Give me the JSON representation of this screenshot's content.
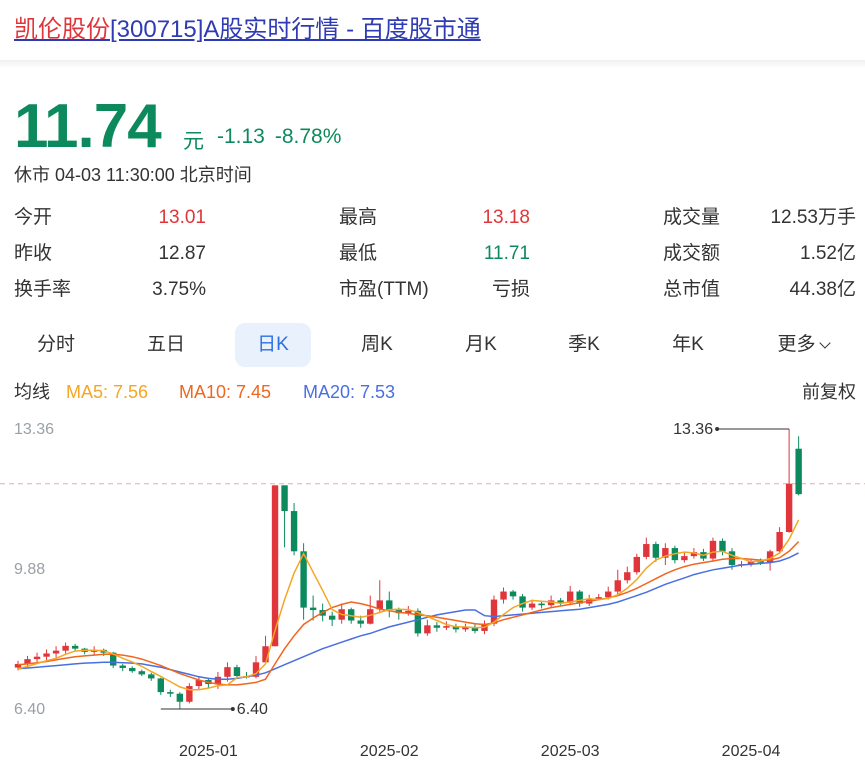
{
  "page_title": {
    "name": "凯伦股份",
    "rest": "[300715]A股实时行情 - 百度股市通"
  },
  "quote": {
    "price": "11.74",
    "unit": "元",
    "change": "-1.13",
    "change_pct": "-8.78%",
    "status": "休市 04-03 11:30:00 北京时间"
  },
  "stats": [
    [
      {
        "label": "今开",
        "value": "13.01",
        "tone": "red"
      },
      {
        "label": "最高",
        "value": "13.18",
        "tone": "red"
      },
      {
        "label": "成交量",
        "value": "12.53万手",
        "tone": "dark"
      }
    ],
    [
      {
        "label": "昨收",
        "value": "12.87",
        "tone": "dark"
      },
      {
        "label": "最低",
        "value": "11.71",
        "tone": "green"
      },
      {
        "label": "成交额",
        "value": "1.52亿",
        "tone": "dark"
      }
    ],
    [
      {
        "label": "换手率",
        "value": "3.75%",
        "tone": "dark"
      },
      {
        "label": "市盈(TTM)",
        "value": "亏损",
        "tone": "dark"
      },
      {
        "label": "总市值",
        "value": "44.38亿",
        "tone": "dark"
      }
    ]
  ],
  "tabs": [
    "分时",
    "五日",
    "日K",
    "周K",
    "月K",
    "季K",
    "年K",
    "更多"
  ],
  "active_tab": "日K",
  "ma_legend": {
    "label": "均线",
    "ma5": "MA5: 7.56",
    "ma10": "MA10: 7.45",
    "ma20": "MA20: 7.53",
    "adjust": "前复权"
  },
  "colors": {
    "up": "#e0353a",
    "down": "#0d8a5d",
    "ma5": "#f5a623",
    "ma10": "#f0661e",
    "ma20": "#4a6fe0",
    "active_tab_bg": "#e9f1fd"
  },
  "chart_data": {
    "type": "candlestick",
    "y_ticks": [
      "13.36",
      "9.88",
      "6.40"
    ],
    "ylim": [
      6.4,
      13.36
    ],
    "x_ticks": [
      "2025-01",
      "2025-02",
      "2025-03",
      "2025-04"
    ],
    "x_tick_index": [
      20,
      39,
      58,
      77
    ],
    "reference_line": 12.0,
    "annotations": [
      {
        "label": "13.36",
        "index": 81,
        "value": 13.36
      },
      {
        "label": "6.40",
        "index": 15,
        "value": 6.4
      }
    ],
    "candles": [
      [
        7.43,
        7.52,
        7.6,
        7.36
      ],
      [
        7.52,
        7.64,
        7.72,
        7.44
      ],
      [
        7.64,
        7.7,
        7.8,
        7.56
      ],
      [
        7.7,
        7.78,
        7.88,
        7.6
      ],
      [
        7.78,
        7.85,
        7.96,
        7.68
      ],
      [
        7.85,
        7.97,
        8.05,
        7.78
      ],
      [
        7.97,
        7.9,
        8.02,
        7.84
      ],
      [
        7.9,
        7.82,
        7.92,
        7.76
      ],
      [
        7.82,
        7.87,
        7.96,
        7.74
      ],
      [
        7.87,
        7.8,
        7.9,
        7.72
      ],
      [
        7.8,
        7.48,
        7.82,
        7.42
      ],
      [
        7.48,
        7.42,
        7.52,
        7.34
      ],
      [
        7.42,
        7.34,
        7.46,
        7.3
      ],
      [
        7.34,
        7.26,
        7.38,
        7.22
      ],
      [
        7.26,
        7.16,
        7.3,
        7.1
      ],
      [
        7.16,
        6.82,
        7.18,
        6.75
      ],
      [
        6.82,
        6.78,
        6.88,
        6.7
      ],
      [
        6.78,
        6.58,
        6.82,
        6.4
      ],
      [
        6.58,
        6.97,
        7.04,
        6.54
      ],
      [
        6.97,
        7.12,
        7.2,
        6.88
      ],
      [
        7.12,
        7.02,
        7.18,
        6.92
      ],
      [
        7.02,
        7.2,
        7.32,
        6.9
      ],
      [
        7.2,
        7.44,
        7.56,
        7.08
      ],
      [
        7.44,
        7.22,
        7.5,
        7.16
      ],
      [
        7.22,
        7.2,
        7.32,
        7.16
      ],
      [
        7.2,
        7.56,
        7.72,
        7.16
      ],
      [
        7.56,
        7.96,
        8.22,
        7.52
      ],
      [
        7.96,
        11.96,
        11.96,
        7.96
      ],
      [
        11.96,
        11.32,
        11.96,
        10.42
      ],
      [
        11.32,
        10.32,
        11.52,
        10.22
      ],
      [
        10.32,
        8.92,
        10.52,
        8.62
      ],
      [
        8.92,
        8.86,
        9.22,
        8.6
      ],
      [
        8.86,
        8.72,
        9.02,
        8.58
      ],
      [
        8.72,
        8.62,
        8.82,
        8.46
      ],
      [
        8.62,
        8.88,
        9.02,
        8.52
      ],
      [
        8.88,
        8.6,
        8.92,
        8.52
      ],
      [
        8.6,
        8.52,
        8.72,
        8.42
      ],
      [
        8.52,
        8.88,
        9.22,
        8.5
      ],
      [
        8.88,
        9.1,
        9.6,
        8.82
      ],
      [
        9.1,
        8.86,
        9.32,
        8.68
      ],
      [
        8.86,
        8.78,
        8.92,
        8.62
      ],
      [
        8.78,
        8.84,
        8.96,
        8.72
      ],
      [
        8.84,
        8.28,
        8.9,
        8.2
      ],
      [
        8.28,
        8.48,
        8.62,
        8.22
      ],
      [
        8.48,
        8.42,
        8.56,
        8.32
      ],
      [
        8.42,
        8.46,
        8.58,
        8.36
      ],
      [
        8.46,
        8.38,
        8.52,
        8.3
      ],
      [
        8.38,
        8.44,
        8.52,
        8.32
      ],
      [
        8.44,
        8.34,
        8.5,
        8.28
      ],
      [
        8.34,
        8.52,
        8.6,
        8.26
      ],
      [
        8.52,
        9.12,
        9.22,
        8.46
      ],
      [
        9.12,
        9.32,
        9.42,
        9.02
      ],
      [
        9.32,
        9.2,
        9.36,
        9.12
      ],
      [
        9.2,
        8.92,
        9.26,
        8.82
      ],
      [
        8.92,
        9.02,
        9.12,
        8.86
      ],
      [
        9.02,
        8.98,
        9.08,
        8.9
      ],
      [
        8.98,
        9.1,
        9.22,
        8.92
      ],
      [
        9.1,
        9.04,
        9.16,
        8.98
      ],
      [
        9.04,
        9.32,
        9.46,
        8.98
      ],
      [
        9.32,
        9.02,
        9.36,
        8.94
      ],
      [
        9.02,
        9.14,
        9.24,
        8.96
      ],
      [
        9.14,
        9.18,
        9.26,
        9.1
      ],
      [
        9.18,
        9.32,
        9.44,
        9.12
      ],
      [
        9.32,
        9.6,
        9.86,
        9.24
      ],
      [
        9.6,
        9.8,
        9.94,
        9.52
      ],
      [
        9.8,
        10.18,
        10.26,
        9.74
      ],
      [
        10.18,
        10.5,
        10.66,
        10.12
      ],
      [
        10.5,
        10.16,
        10.56,
        10.06
      ],
      [
        10.16,
        10.4,
        10.52,
        9.98
      ],
      [
        10.4,
        10.1,
        10.46,
        10.02
      ],
      [
        10.1,
        10.2,
        10.3,
        10.04
      ],
      [
        10.2,
        10.3,
        10.4,
        10.14
      ],
      [
        10.3,
        10.14,
        10.38,
        10.08
      ],
      [
        10.14,
        10.58,
        10.66,
        10.06
      ],
      [
        10.58,
        10.32,
        10.64,
        10.22
      ],
      [
        10.32,
        9.98,
        10.4,
        9.86
      ],
      [
        9.98,
        10.0,
        10.08,
        9.92
      ],
      [
        10.0,
        10.08,
        10.12,
        9.94
      ],
      [
        10.08,
        10.04,
        10.14,
        9.98
      ],
      [
        10.04,
        10.32,
        10.36,
        9.84
      ],
      [
        10.32,
        10.8,
        10.92,
        10.26
      ],
      [
        10.8,
        12.0,
        13.36,
        10.78
      ],
      [
        12.87,
        11.74,
        13.18,
        11.71
      ]
    ],
    "ma5": [
      7.4,
      7.46,
      7.53,
      7.6,
      7.66,
      7.76,
      7.84,
      7.86,
      7.86,
      7.85,
      7.77,
      7.66,
      7.57,
      7.46,
      7.33,
      7.21,
      7.08,
      6.95,
      6.88,
      6.88,
      6.92,
      6.98,
      7.0,
      7.18,
      7.2,
      7.28,
      7.52,
      8.35,
      9.12,
      9.78,
      10.26,
      9.8,
      9.35,
      8.87,
      8.75,
      8.72,
      8.68,
      8.73,
      8.8,
      8.87,
      8.88,
      8.87,
      8.8,
      8.7,
      8.6,
      8.5,
      8.44,
      8.44,
      8.42,
      8.43,
      8.56,
      8.75,
      8.92,
      9.02,
      9.1,
      9.08,
      9.06,
      9.03,
      9.06,
      9.1,
      9.14,
      9.12,
      9.15,
      9.24,
      9.4,
      9.62,
      9.9,
      10.1,
      10.2,
      10.26,
      10.3,
      10.28,
      10.22,
      10.3,
      10.32,
      10.22,
      10.14,
      10.06,
      10.08,
      10.14,
      10.28,
      10.62,
      11.1
    ],
    "ma10": [
      7.5,
      7.52,
      7.55,
      7.58,
      7.62,
      7.66,
      7.7,
      7.72,
      7.74,
      7.76,
      7.76,
      7.74,
      7.7,
      7.64,
      7.56,
      7.48,
      7.38,
      7.28,
      7.2,
      7.12,
      7.06,
      7.02,
      7.0,
      7.0,
      7.03,
      7.06,
      7.14,
      7.52,
      7.9,
      8.22,
      8.5,
      8.66,
      8.8,
      8.92,
      9.0,
      9.06,
      9.02,
      8.96,
      8.88,
      8.84,
      8.8,
      8.78,
      8.74,
      8.72,
      8.68,
      8.64,
      8.6,
      8.56,
      8.52,
      8.5,
      8.54,
      8.62,
      8.68,
      8.74,
      8.8,
      8.86,
      8.92,
      8.96,
      9.0,
      9.04,
      9.08,
      9.12,
      9.16,
      9.22,
      9.3,
      9.4,
      9.52,
      9.64,
      9.76,
      9.86,
      9.94,
      10.0,
      10.04,
      10.08,
      10.12,
      10.14,
      10.14,
      10.12,
      10.1,
      10.1,
      10.16,
      10.32,
      10.56
    ],
    "ma20": [
      7.4,
      7.42,
      7.44,
      7.46,
      7.48,
      7.5,
      7.52,
      7.54,
      7.55,
      7.56,
      7.56,
      7.55,
      7.54,
      7.52,
      7.48,
      7.44,
      7.38,
      7.32,
      7.26,
      7.2,
      7.16,
      7.14,
      7.14,
      7.16,
      7.2,
      7.24,
      7.3,
      7.4,
      7.5,
      7.6,
      7.7,
      7.8,
      7.9,
      7.98,
      8.06,
      8.14,
      8.22,
      8.28,
      8.36,
      8.44,
      8.5,
      8.56,
      8.62,
      8.68,
      8.74,
      8.78,
      8.82,
      8.86,
      8.86,
      8.72,
      8.7,
      8.72,
      8.74,
      8.76,
      8.78,
      8.8,
      8.82,
      8.84,
      8.86,
      8.88,
      8.92,
      8.96,
      9.0,
      9.06,
      9.14,
      9.22,
      9.3,
      9.4,
      9.5,
      9.58,
      9.66,
      9.74,
      9.8,
      9.86,
      9.9,
      9.94,
      9.98,
      10.0,
      10.02,
      10.04,
      10.08,
      10.16,
      10.28
    ]
  }
}
